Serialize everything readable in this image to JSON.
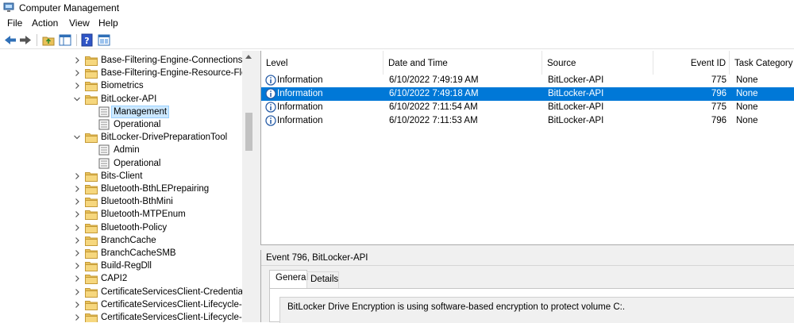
{
  "window": {
    "title": "Computer Management"
  },
  "menu": [
    "File",
    "Action",
    "View",
    "Help"
  ],
  "toolbar": [
    "back-icon",
    "forward-icon",
    "up-folder-icon",
    "show-hide-tree-icon",
    "help-icon",
    "properties-icon"
  ],
  "tree": {
    "items": [
      {
        "label": "Base-Filtering-Engine-Connections",
        "kind": "folder",
        "expanded": false,
        "level": 0
      },
      {
        "label": "Base-Filtering-Engine-Resource-Flow",
        "kind": "folder",
        "expanded": false,
        "level": 0
      },
      {
        "label": "Biometrics",
        "kind": "folder",
        "expanded": false,
        "level": 0
      },
      {
        "label": "BitLocker-API",
        "kind": "folder",
        "expanded": true,
        "level": 0
      },
      {
        "label": "Management",
        "kind": "log",
        "level": 1,
        "selected": true
      },
      {
        "label": "Operational",
        "kind": "log",
        "level": 1
      },
      {
        "label": "BitLocker-DrivePreparationTool",
        "kind": "folder",
        "expanded": true,
        "level": 0
      },
      {
        "label": "Admin",
        "kind": "log",
        "level": 1
      },
      {
        "label": "Operational",
        "kind": "log",
        "level": 1
      },
      {
        "label": "Bits-Client",
        "kind": "folder",
        "expanded": false,
        "level": 0
      },
      {
        "label": "Bluetooth-BthLEPrepairing",
        "kind": "folder",
        "expanded": false,
        "level": 0
      },
      {
        "label": "Bluetooth-BthMini",
        "kind": "folder",
        "expanded": false,
        "level": 0
      },
      {
        "label": "Bluetooth-MTPEnum",
        "kind": "folder",
        "expanded": false,
        "level": 0
      },
      {
        "label": "Bluetooth-Policy",
        "kind": "folder",
        "expanded": false,
        "level": 0
      },
      {
        "label": "BranchCache",
        "kind": "folder",
        "expanded": false,
        "level": 0
      },
      {
        "label": "BranchCacheSMB",
        "kind": "folder",
        "expanded": false,
        "level": 0
      },
      {
        "label": "Build-RegDll",
        "kind": "folder",
        "expanded": false,
        "level": 0
      },
      {
        "label": "CAPI2",
        "kind": "folder",
        "expanded": false,
        "level": 0
      },
      {
        "label": "CertificateServicesClient-CredentialRo",
        "kind": "folder",
        "expanded": false,
        "level": 0
      },
      {
        "label": "CertificateServicesClient-Lifecycle-Sy",
        "kind": "folder",
        "expanded": false,
        "level": 0
      },
      {
        "label": "CertificateServicesClient-Lifecycle-Us",
        "kind": "folder",
        "expanded": false,
        "level": 0
      }
    ]
  },
  "events": {
    "columns": [
      "Level",
      "Date and Time",
      "Source",
      "Event ID",
      "Task Category"
    ],
    "rows": [
      {
        "level": "Information",
        "datetime": "6/10/2022 7:49:19 AM",
        "source": "BitLocker-API",
        "event_id": "775",
        "task": "None",
        "selected": false
      },
      {
        "level": "Information",
        "datetime": "6/10/2022 7:49:18 AM",
        "source": "BitLocker-API",
        "event_id": "796",
        "task": "None",
        "selected": true
      },
      {
        "level": "Information",
        "datetime": "6/10/2022 7:11:54 AM",
        "source": "BitLocker-API",
        "event_id": "775",
        "task": "None",
        "selected": false
      },
      {
        "level": "Information",
        "datetime": "6/10/2022 7:11:53 AM",
        "source": "BitLocker-API",
        "event_id": "796",
        "task": "None",
        "selected": false
      }
    ]
  },
  "detail": {
    "title": "Event 796, BitLocker-API",
    "tabs": [
      "General",
      "Details"
    ],
    "active_tab": "General",
    "description": "BitLocker Drive Encryption is using software-based encryption to protect volume C:."
  },
  "colors": {
    "selection": "#0078d7",
    "tree_selection": "#cce8ff",
    "folder": "#e8c15a"
  }
}
